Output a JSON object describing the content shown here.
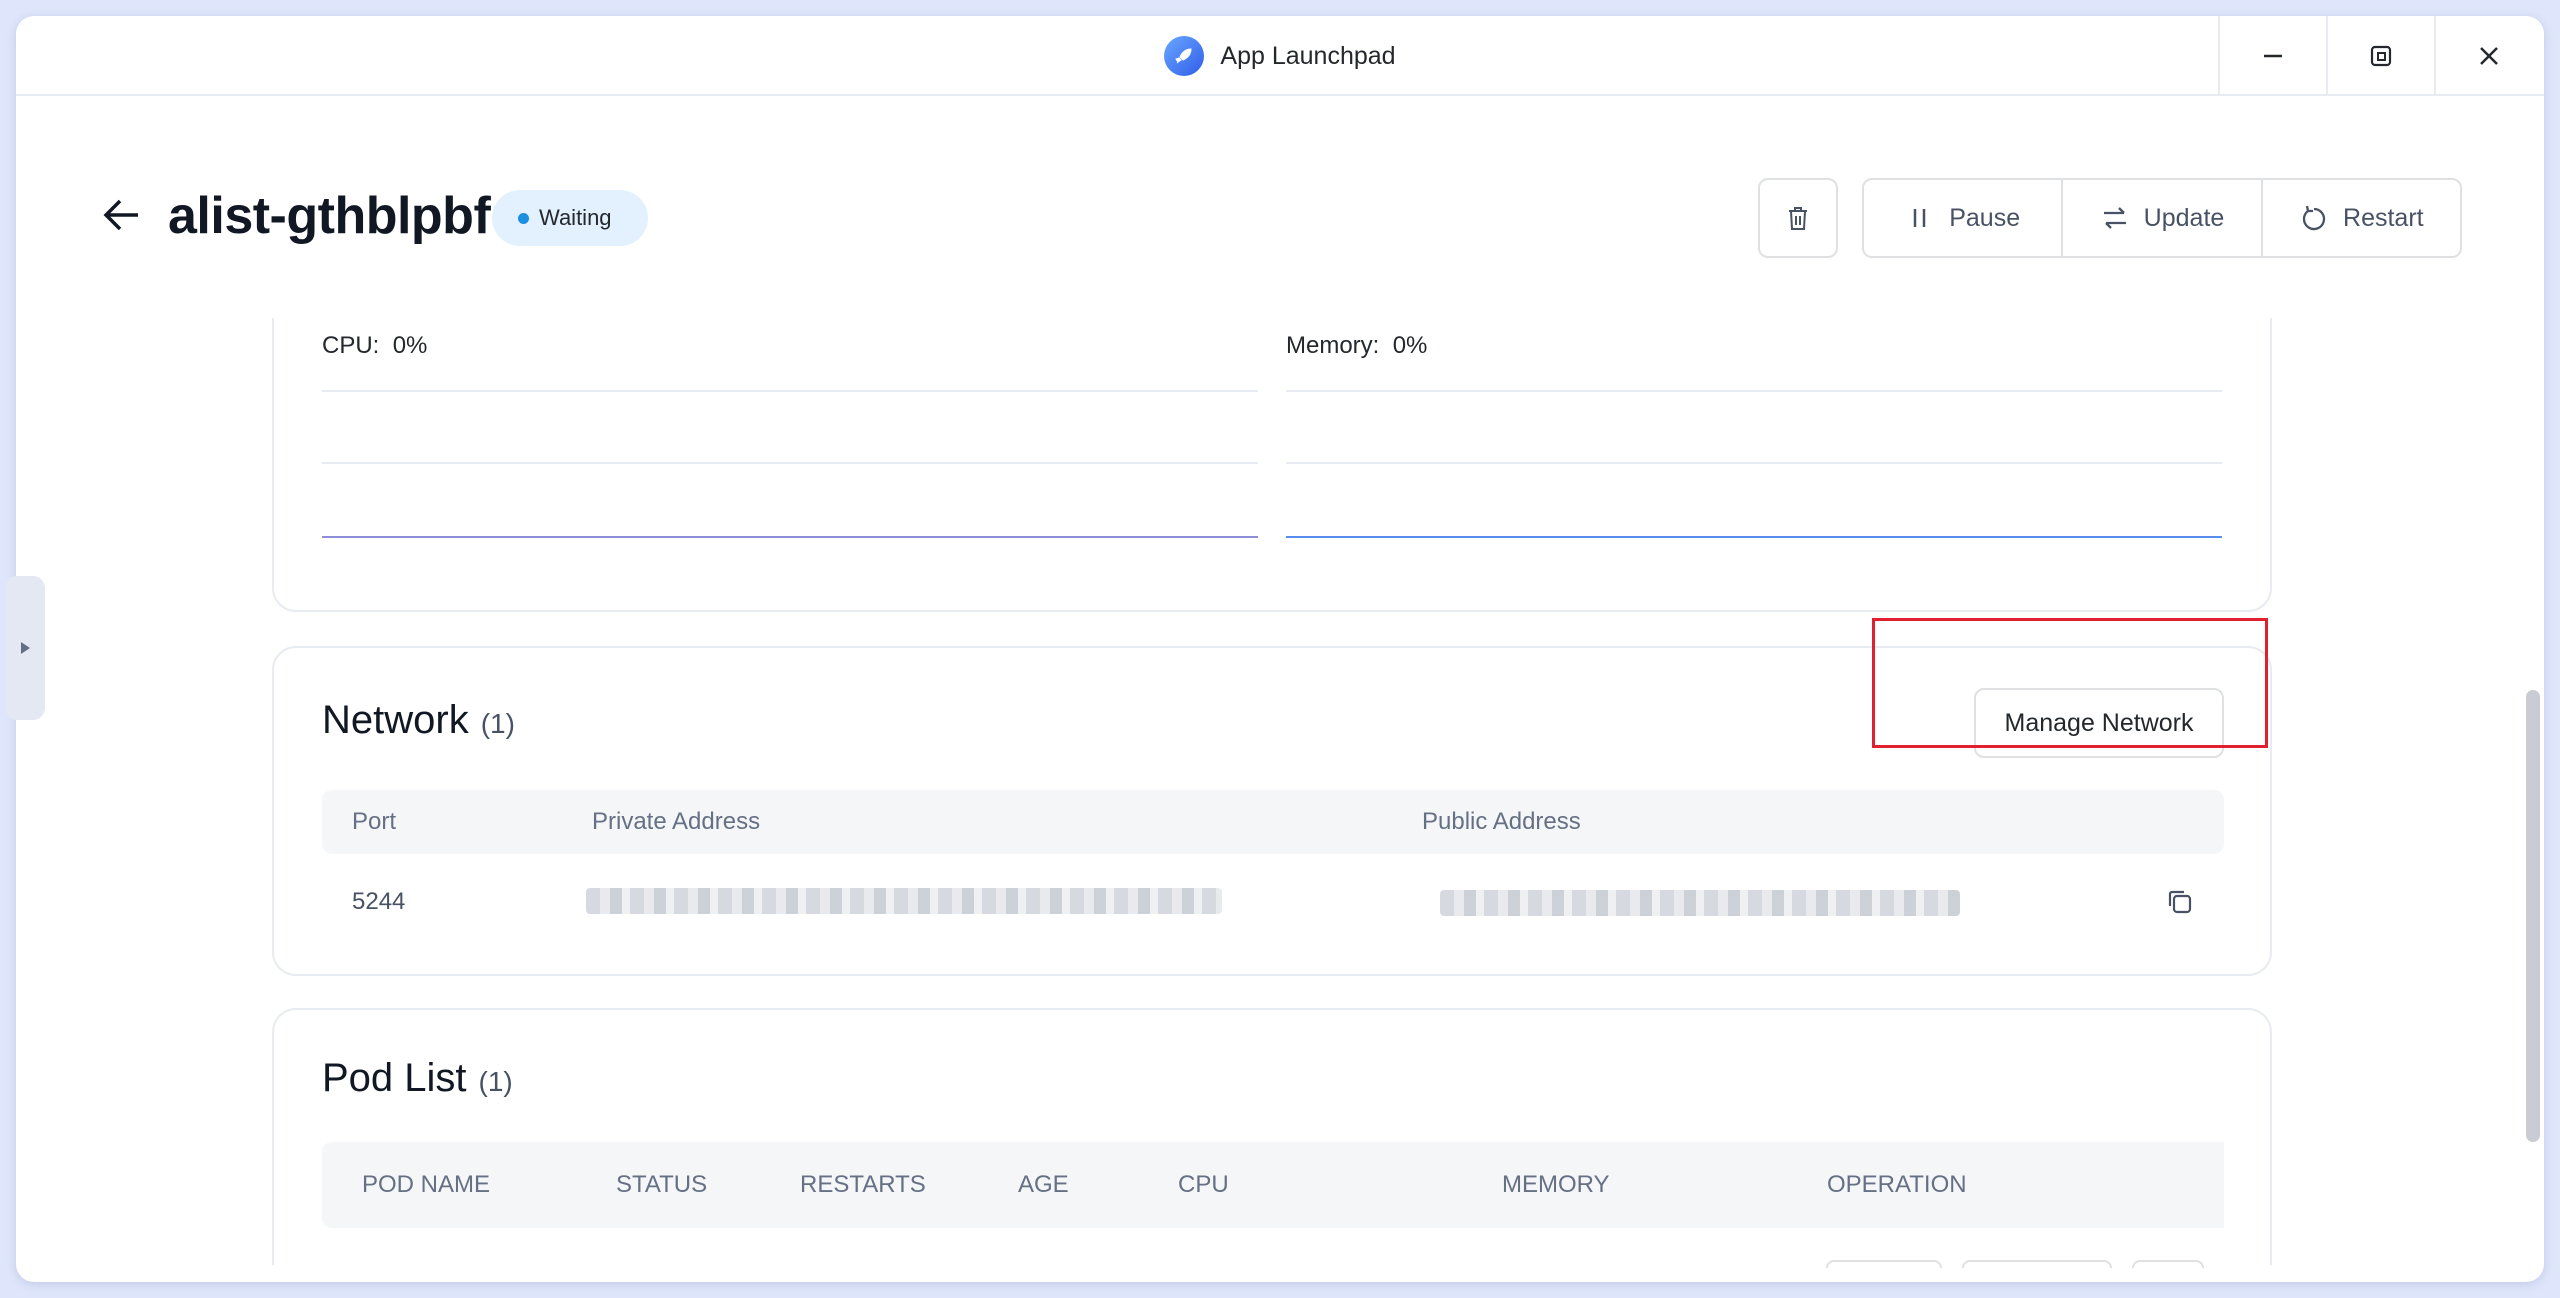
{
  "window": {
    "title": "App Launchpad",
    "controls": [
      "minimize",
      "maximize",
      "close"
    ]
  },
  "header": {
    "app_name": "alist-gthblpbf",
    "status": "Waiting",
    "status_color": "#1d8fe1",
    "actions": {
      "pause": "Pause",
      "update": "Update",
      "restart": "Restart"
    }
  },
  "monitor": {
    "cpu_label": "CPU:",
    "cpu_value": "0%",
    "memory_label": "Memory:",
    "memory_value": "0%"
  },
  "network": {
    "title": "Network",
    "count": "(1)",
    "manage_label": "Manage Network",
    "columns": [
      "Port",
      "Private Address",
      "Public Address"
    ],
    "rows": [
      {
        "port": "5244"
      }
    ]
  },
  "pods": {
    "title": "Pod List",
    "count": "(1)",
    "columns": [
      "POD NAME",
      "STATUS",
      "RESTARTS",
      "AGE",
      "CPU",
      "MEMORY",
      "OPERATION"
    ]
  },
  "colors": {
    "highlight": "#e0202e",
    "cpu_line": "#8c8fd8",
    "memory_line": "#5b8def"
  }
}
